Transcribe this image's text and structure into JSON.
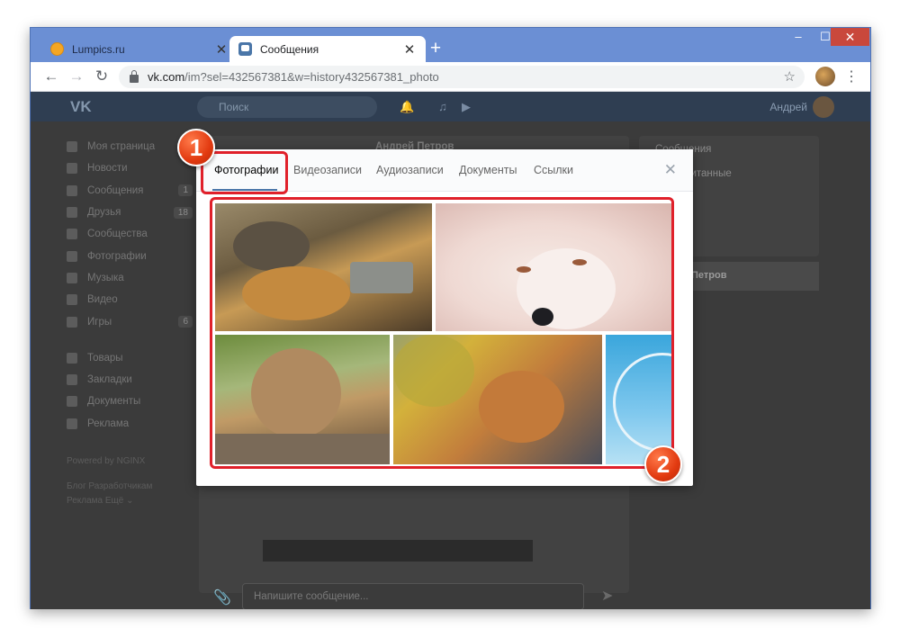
{
  "browser": {
    "tabs": [
      {
        "title": "Lumpics.ru",
        "active": false
      },
      {
        "title": "Сообщения",
        "active": true
      }
    ],
    "new_tab": "+",
    "window_controls": {
      "minimize": "–",
      "maximize": "☐",
      "close": "✕"
    },
    "url_host": "vk.com",
    "url_path": "/im?sel=432567381&w=history432567381_photo"
  },
  "vk_header": {
    "logo": "VK",
    "search_placeholder": "Поиск",
    "user_name": "Андрей"
  },
  "sidebar": {
    "items": [
      {
        "label": "Моя страница",
        "count": ""
      },
      {
        "label": "Новости",
        "count": ""
      },
      {
        "label": "Сообщения",
        "count": "1"
      },
      {
        "label": "Друзья",
        "count": "18"
      },
      {
        "label": "Сообщества",
        "count": ""
      },
      {
        "label": "Фотографии",
        "count": ""
      },
      {
        "label": "Музыка",
        "count": ""
      },
      {
        "label": "Видео",
        "count": ""
      },
      {
        "label": "Игры",
        "count": "6"
      }
    ],
    "items2": [
      {
        "label": "Товары"
      },
      {
        "label": "Закладки"
      },
      {
        "label": "Документы"
      },
      {
        "label": "Реклама"
      }
    ],
    "powered": "Powered by NGINX",
    "footer1": "Блог   Разработчикам",
    "footer2": "Реклама   Ещё ⌄"
  },
  "chat": {
    "contact_name": "Андрей Петров",
    "input_placeholder": "Напишите сообщение..."
  },
  "right_panel": {
    "items": [
      "Сообщения",
      "Непрочитанные",
      ""
    ],
    "bold_item": "Петров"
  },
  "modal": {
    "tabs": [
      "Фотографии",
      "Видеозаписи",
      "Аудиозаписи",
      "Документы",
      "Ссылки"
    ],
    "selected_tab": "Фотографии",
    "close": "✕"
  },
  "annotations": {
    "badge1": "1",
    "badge2": "2",
    "highlight_color": "#e0202a"
  },
  "colors": {
    "vk_blue": "#4a76a8",
    "chrome_frame": "#6b8fd4",
    "overlay_bg": "#3b3b3b"
  }
}
